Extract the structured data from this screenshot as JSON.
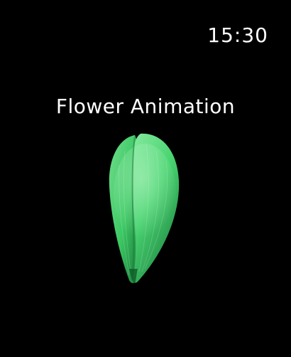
{
  "status_bar": {
    "time": "15:30"
  },
  "screen": {
    "title": "Flower Animation"
  },
  "petal": {
    "icon": "leaf-petal",
    "colors": {
      "light": "#7fe59a",
      "mid": "#3fcf6a",
      "dark": "#1e8f43",
      "shadow": "#0f5a28"
    }
  },
  "colors": {
    "background": "#000000",
    "text": "#ffffff"
  }
}
